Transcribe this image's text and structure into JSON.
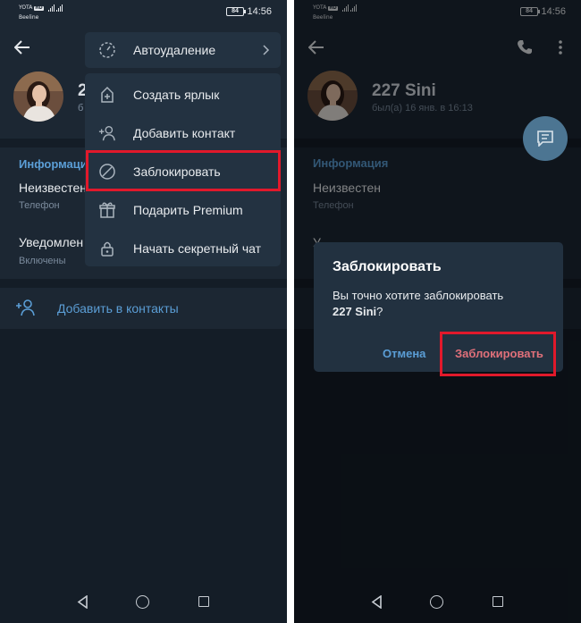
{
  "status_bar": {
    "carrier_1": "YOTA",
    "carrier_tag": "HD",
    "carrier_2": "Beeline",
    "battery": "84",
    "time": "14:56"
  },
  "contact": {
    "name_partial": "2",
    "last_seen_partial": "б",
    "name": "227 Sini",
    "last_seen": "был(а) 16 янв. в 16:13"
  },
  "info": {
    "header": "Информация",
    "phone_value": "Неизвестен",
    "phone_label": "Телефон",
    "notifications_partial": "Уведомлен",
    "notifications_state": "Включены",
    "notifications_partial_right": "У"
  },
  "add_to_contacts": "Добавить в контакты",
  "menu": {
    "autodelete": "Автоудаление",
    "items": [
      {
        "label": "Создать ярлык",
        "icon": "add-shortcut-icon"
      },
      {
        "label": "Добавить контакт",
        "icon": "add-contact-icon"
      },
      {
        "label": "Заблокировать",
        "icon": "block-icon"
      },
      {
        "label": "Подарить Premium",
        "icon": "gift-icon"
      },
      {
        "label": "Начать секретный чат",
        "icon": "lock-icon"
      }
    ]
  },
  "dialog": {
    "title": "Заблокировать",
    "message": "Вы точно хотите заблокировать",
    "target": "227 Sini",
    "suffix": "?",
    "cancel": "Отмена",
    "confirm": "Заблокировать"
  },
  "colors": {
    "background": "#1c2733",
    "accent": "#5b9ed6",
    "danger": "#e0707a",
    "highlight": "#e1192b"
  }
}
